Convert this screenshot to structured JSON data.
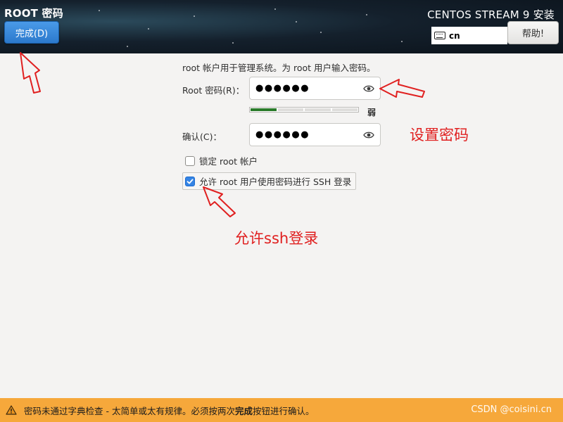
{
  "header": {
    "spoke_title": "ROOT 密码",
    "done_label": "完成(D)",
    "product_title": "CENTOS STREAM 9 安装",
    "keyboard_layout": "cn",
    "help_label": "帮助!"
  },
  "form": {
    "intro_text": "root 帐户用于管理系统。为 root 用户输入密码。",
    "password_label": "Root 密码(R)：",
    "password_value": "●●●●●●",
    "strength_label": "弱",
    "strength_level_fraction": 0.25,
    "confirm_label": "确认(C)：",
    "confirm_value": "●●●●●●",
    "lock_root_label": "锁定 root 帐户",
    "lock_root_checked": false,
    "allow_ssh_label": "允许 root 用户使用密码进行 SSH 登录",
    "allow_ssh_checked": true
  },
  "annotations": {
    "set_password": "设置密码",
    "allow_ssh": "允许ssh登录",
    "color": "#e02020"
  },
  "footer": {
    "warning_prefix": "密码未通过字典检查 - 太简单或太有规律。必须按两次",
    "warning_bold": "完成",
    "warning_suffix": "按钮进行确认。",
    "watermark": "CSDN @coisini.cn",
    "bg_color": "#f6a83b"
  }
}
